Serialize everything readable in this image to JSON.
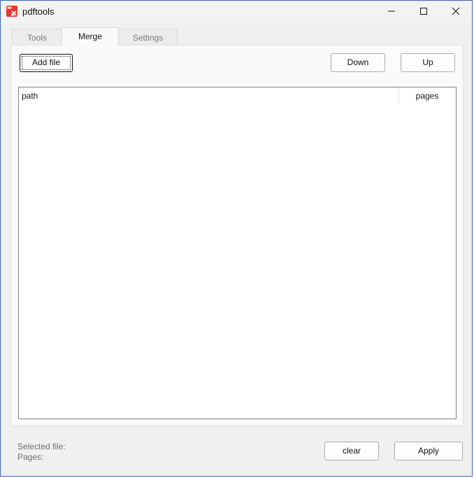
{
  "window": {
    "title": "pdftools",
    "icon": "pdftools-app-icon"
  },
  "tabs": [
    {
      "label": "Tools",
      "active": false
    },
    {
      "label": "Merge",
      "active": true
    },
    {
      "label": "Settings",
      "active": false
    }
  ],
  "toolbar": {
    "add_file_label": "Add file",
    "down_label": "Down",
    "up_label": "Up"
  },
  "file_list": {
    "columns": [
      "path",
      "pages"
    ],
    "rows": []
  },
  "info": {
    "selected_file_label": "Selected file:",
    "pages_label": "Pages:"
  },
  "actions": {
    "clear_label": "clear",
    "apply_label": "Apply"
  },
  "colors": {
    "accent": "#3a63b8",
    "icon_red": "#e53935"
  }
}
